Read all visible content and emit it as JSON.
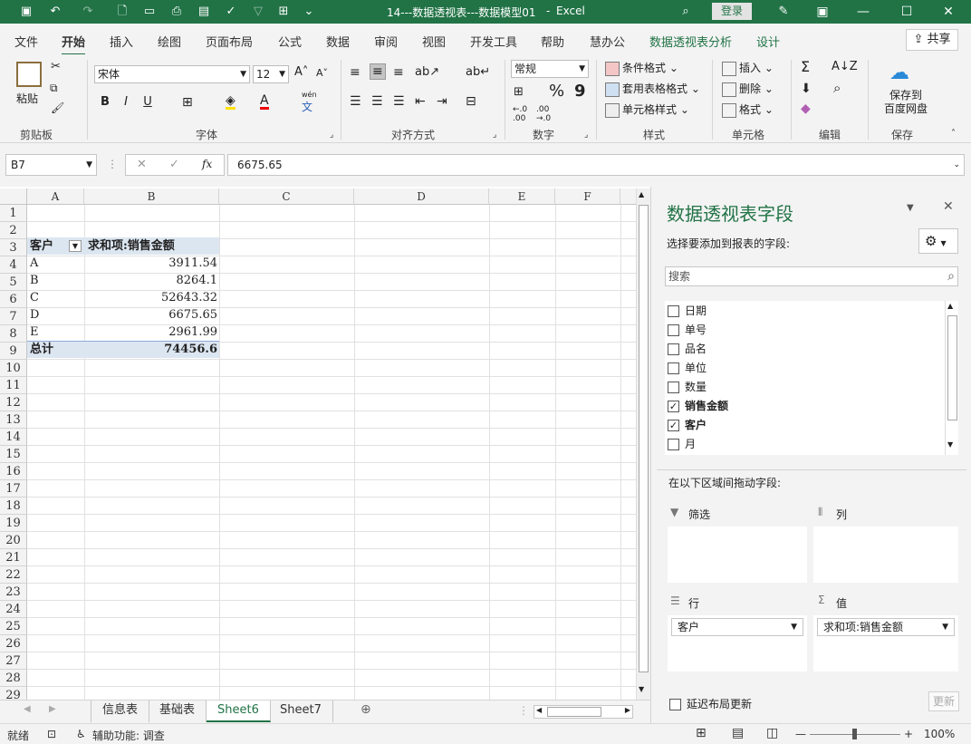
{
  "title": {
    "filename": "14---数据透视表---数据模型01",
    "sep": "-",
    "app": "Excel",
    "login": "登录"
  },
  "tabs": [
    "文件",
    "开始",
    "插入",
    "绘图",
    "页面布局",
    "公式",
    "数据",
    "审阅",
    "视图",
    "开发工具",
    "帮助",
    "慧办公",
    "数据透视表分析",
    "设计"
  ],
  "share": "共享",
  "ribbon": {
    "clipboard": {
      "paste": "粘贴",
      "label": "剪贴板"
    },
    "font": {
      "name": "宋体",
      "size": "12",
      "label": "字体",
      "bold": "B",
      "italic": "I",
      "underline": "U",
      "wen": "wén",
      "wenchar": "文"
    },
    "align": {
      "label": "对齐方式"
    },
    "number": {
      "format": "常规",
      "label": "数字",
      "pct": "%",
      "comma": "9"
    },
    "styles": {
      "cond": "条件格式",
      "table": "套用表格格式",
      "cell": "单元格样式",
      "label": "样式"
    },
    "cells": {
      "insert": "插入",
      "delete": "删除",
      "format": "格式",
      "label": "单元格"
    },
    "edit": {
      "sum": "Σ",
      "label": "编辑"
    },
    "save": {
      "line1": "保存到",
      "line2": "百度网盘",
      "label": "保存"
    }
  },
  "formula": {
    "name": "B7",
    "value": "6675.65",
    "fx": "fx"
  },
  "columns": [
    "A",
    "B",
    "C",
    "D",
    "E",
    "F"
  ],
  "rows": [
    "1",
    "2",
    "3",
    "4",
    "5",
    "6",
    "7",
    "8",
    "9",
    "10",
    "11",
    "12",
    "13",
    "14",
    "15",
    "16",
    "17",
    "18",
    "19",
    "20",
    "21",
    "22",
    "23",
    "24",
    "25",
    "26",
    "27",
    "28",
    "29"
  ],
  "pivot": {
    "header_a": "客户",
    "header_b": "求和项:销售金额",
    "data": [
      {
        "name": "A",
        "value": "3911.54"
      },
      {
        "name": "B",
        "value": "8264.1"
      },
      {
        "name": "C",
        "value": "52643.32"
      },
      {
        "name": "D",
        "value": "6675.65"
      },
      {
        "name": "E",
        "value": "2961.99"
      }
    ],
    "total_label": "总计",
    "total_value": "74456.6"
  },
  "sheets": [
    "信息表",
    "基础表",
    "Sheet6",
    "Sheet7"
  ],
  "status": {
    "ready": "就绪",
    "access": "辅助功能: 调查",
    "zoom": "100%"
  },
  "pane": {
    "title": "数据透视表字段",
    "subtitle": "选择要添加到报表的字段:",
    "search": "搜索",
    "fields": [
      {
        "name": "日期",
        "checked": false
      },
      {
        "name": "单号",
        "checked": false
      },
      {
        "name": "品名",
        "checked": false
      },
      {
        "name": "单位",
        "checked": false
      },
      {
        "name": "数量",
        "checked": false
      },
      {
        "name": "销售金额",
        "checked": true
      },
      {
        "name": "客户",
        "checked": true
      },
      {
        "name": "月",
        "checked": false
      }
    ],
    "drag_hint": "在以下区域间拖动字段:",
    "filters": "筛选",
    "columns": "列",
    "rows": "行",
    "values": "值",
    "rows_item": "客户",
    "values_item": "求和项:销售金额",
    "defer": "延迟布局更新",
    "update": "更新"
  }
}
